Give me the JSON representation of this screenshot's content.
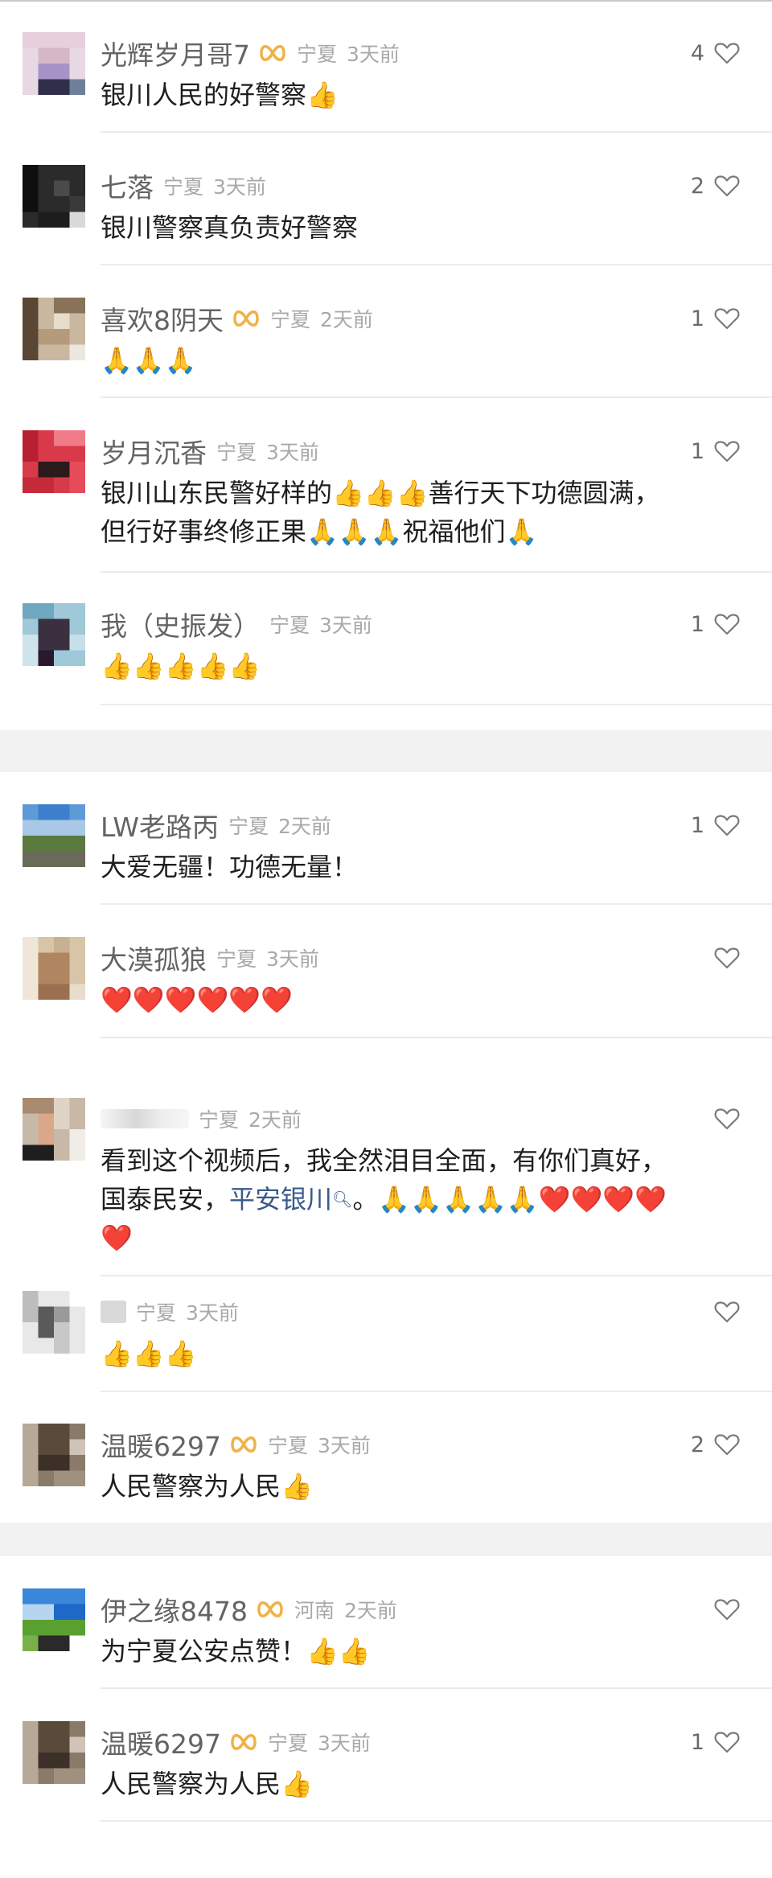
{
  "comments": [
    {
      "user": "光辉岁月哥7",
      "region": "宁夏",
      "time": "3天前",
      "text": "银川人民的好警察👍",
      "likes": "4",
      "has_badge": true
    },
    {
      "user": "七落",
      "region": "宁夏",
      "time": "3天前",
      "text": "银川警察真负责好警察",
      "likes": "2",
      "has_badge": false
    },
    {
      "user": "喜欢8阴天",
      "region": "宁夏",
      "time": "2天前",
      "text": "🙏🙏🙏",
      "likes": "1",
      "has_badge": true
    },
    {
      "user": "岁月沉香",
      "region": "宁夏",
      "time": "3天前",
      "text": "银川山东民警好样的👍👍👍善行天下功德圆满，\n但行好事终修正果🙏🙏🙏祝福他们🙏",
      "likes": "1",
      "has_badge": false
    },
    {
      "user": "我（史振发）",
      "region": "宁夏",
      "time": "3天前",
      "text": "👍👍👍👍👍",
      "likes": "1",
      "has_badge": false
    },
    {
      "user": "LW老路丙",
      "region": "宁夏",
      "time": "2天前",
      "text": "大爱无疆！功德无量！",
      "likes": "1",
      "has_badge": false
    },
    {
      "user": "大漠孤狼",
      "region": "宁夏",
      "time": "3天前",
      "text": "❤️❤️❤️❤️❤️❤️",
      "likes": "",
      "has_badge": false
    },
    {
      "user": "",
      "region": "宁夏",
      "time": "2天前",
      "text_before": "看到这个视频后，我全然泪目全面，有你们真好，\n国泰民安，",
      "link": "平安银川",
      "text_after": "。🙏🙏🙏🙏🙏❤️❤️❤️❤️\n❤️",
      "likes": "",
      "has_badge": false
    },
    {
      "user": "",
      "region": "宁夏",
      "time": "3天前",
      "text": "👍👍👍",
      "likes": "",
      "has_badge": false
    },
    {
      "user": "温暖6297",
      "region": "宁夏",
      "time": "3天前",
      "text": "人民警察为人民👍",
      "likes": "2",
      "has_badge": true
    },
    {
      "user": "伊之缘8478",
      "region": "河南",
      "time": "2天前",
      "text": "为宁夏公安点赞！👍👍",
      "likes": "",
      "has_badge": true
    },
    {
      "user": "温暖6297",
      "region": "宁夏",
      "time": "3天前",
      "text": "人民警察为人民👍",
      "likes": "1",
      "has_badge": true
    }
  ],
  "icons": {
    "like": "heart-outline-icon",
    "badge": "fan-badge-icon",
    "search": "search-icon"
  },
  "colors": {
    "badge": "#f0b246",
    "link": "#3a5a8c",
    "meta": "#a9a9a9"
  }
}
